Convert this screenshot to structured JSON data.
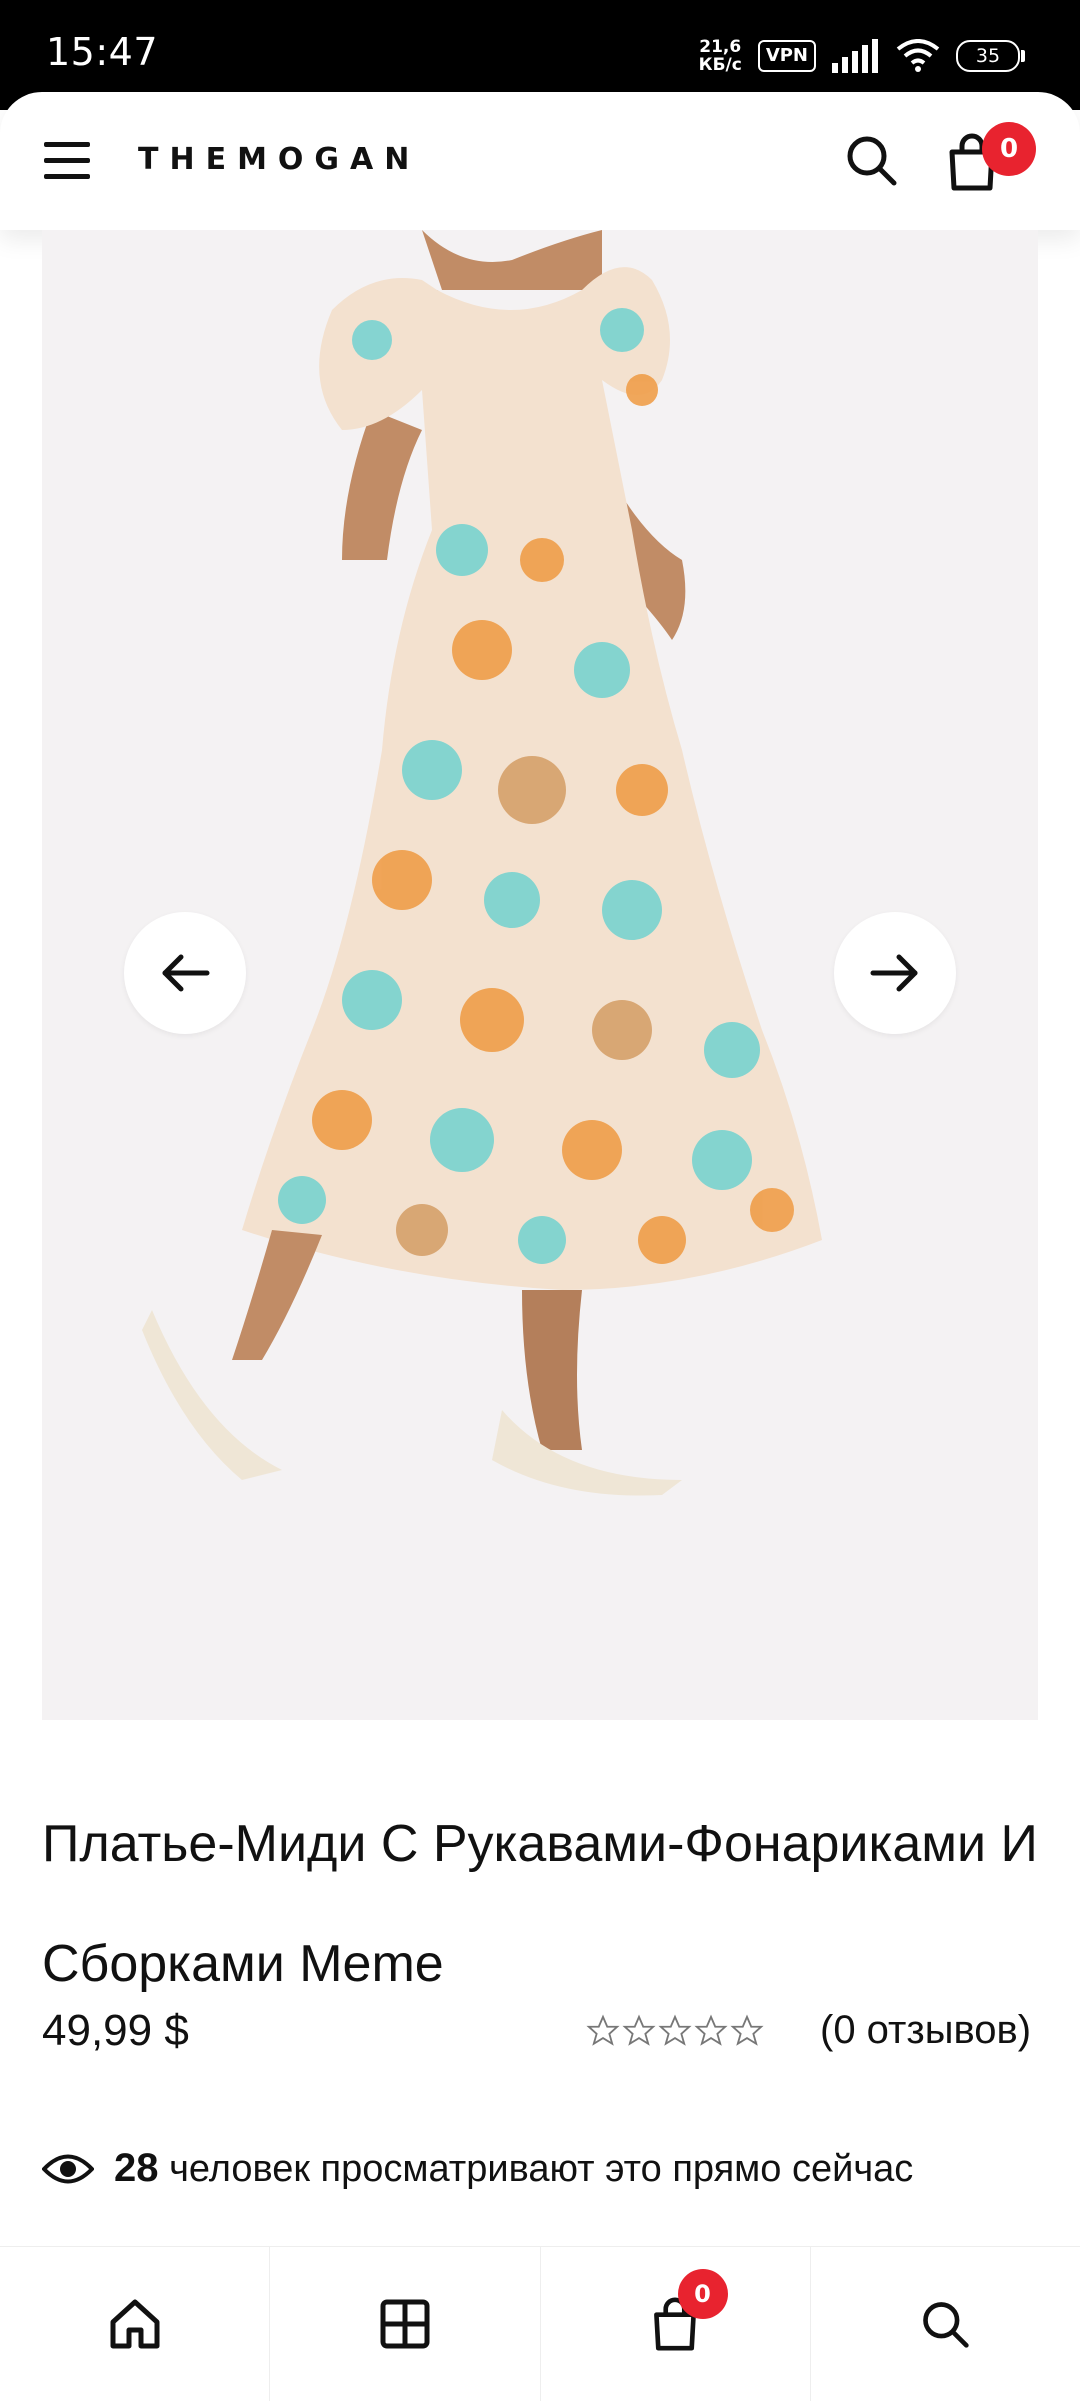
{
  "status_bar": {
    "time": "15:47",
    "net_speed": "21,6\nКБ/с",
    "vpn": "VPN",
    "battery": "35"
  },
  "header": {
    "brand": "THEMOGAN",
    "cart_count": "0"
  },
  "product": {
    "title": "Платье-Миди С Рукавами-Фонариками И Сборками Meme",
    "price": "49,99 $",
    "rating": 0,
    "reviews": "(0 отзывов)",
    "viewers_count": "28",
    "viewers_text": "человек просматривают это прямо сейчас"
  },
  "bottom_nav": {
    "cart_count": "0"
  },
  "colors": {
    "accent": "#e8232f",
    "image_bg": "#f4f2f3"
  }
}
